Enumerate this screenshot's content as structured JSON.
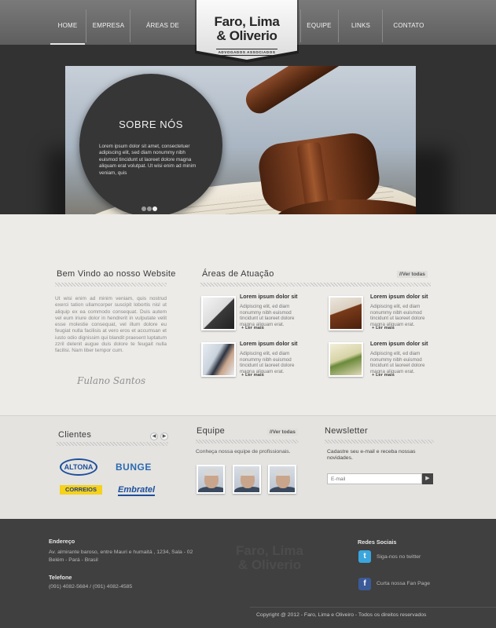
{
  "nav": {
    "items": [
      "HOME",
      "EMPRESA",
      "ÁREAS DE ATUAÇÃO",
      "EQUIPE",
      "LINKS",
      "CONTATO"
    ],
    "active": "HOME"
  },
  "logo": {
    "line1": "Faro, Lima",
    "line2": "& Oliverio",
    "subtitle": "ADVOGADOS ASSOCIADOS"
  },
  "hero": {
    "title": "SOBRE NÓS",
    "text": "Lorem ipsum dolor sit amet, consectetuer adipiscing elit, sed diam nonummy nibh euismod tincidunt ut laoreet dolore magna aliquam erat volutpat. Ut wisi enim ad minim veniam, quis",
    "slides": 3,
    "active_slide": 3
  },
  "welcome": {
    "title": "Bem Vindo ao nosso Website",
    "text": "Ut wisi enim ad minim veniam, quis nostrud exerci tation ullamcorper suscipit lobortis nisl ut aliquip ex ea commodo consequat. Duis autem vel eum iriure dolor in hendrerit in vulputate velit esse molestie consequat, vel illum dolore eu feugiat nulla facilisis at vero eros et accumsan et iusto odio dignissim qui blandit praesent luptatum zzril delenit augue duis dolore te feugait nulla facilisi. Nam liber tempor cum.",
    "signature": "Fulano Santos"
  },
  "areas": {
    "title": "Áreas de Atuação",
    "see_all": "//Ver todas",
    "items": [
      {
        "title": "Lorem ipsum dolor sit",
        "text": "Adipiscing elit, ed diam nonummy nibh euismod tincidunt ut laoreet dolore magna aliquam erat.",
        "more": "+ Ler mais"
      },
      {
        "title": "Lorem ipsum dolor sit",
        "text": "Adipiscing elit, ed diam nonummy nibh euismod tincidunt ut laoreet dolore magna aliquam erat.",
        "more": "+ Ler mais"
      },
      {
        "title": "Lorem ipsum dolor sit",
        "text": "Adipiscing elit, ed diam nonummy nibh euismod tincidunt ut laoreet dolore magna aliquam erat.",
        "more": "+ Ler mais"
      },
      {
        "title": "Lorem ipsum dolor sit",
        "text": "Adipiscing elit, ed diam nonummy nibh euismod tincidunt ut laoreet dolore magna aliquam erat.",
        "more": "+ Ler mais"
      }
    ]
  },
  "clients": {
    "title": "Clientes",
    "logos": [
      "ALTONA",
      "BUNGE",
      "CORREIOS",
      "Embratel"
    ]
  },
  "team": {
    "title": "Equipe",
    "see_all": "//Ver todas",
    "text": "Conheça nossa equipe de profissionais."
  },
  "newsletter": {
    "title": "Newsletter",
    "text": "Cadastre seu e-mail e receba nossas novidades.",
    "placeholder": "E-mail",
    "submit": "▶"
  },
  "footer": {
    "address_label": "Endereço",
    "address_line1": "Av. almirante baroso, entre Mauri e humaitá , 1234, Sala - 02",
    "address_line2": "Belém - Pará - Brasil",
    "phone_label": "Telefone",
    "phones": "(091) 4082-5684 / (091) 4082-4585",
    "social_label": "Redes Sociais",
    "twitter": "Siga-nos no twitter",
    "facebook": "Curta nossa Fan Page",
    "copyright": "Copyright @ 2012 - Faro, Lima e Oliveiro - Todos os direitos reservados",
    "logo_line1": "Faro, Lima",
    "logo_line2": "& Oliverio"
  },
  "colors": {
    "nav": "#6b6b6b",
    "hero_bg": "#323232",
    "footer": "#404040",
    "twitter": "#3aa6dd",
    "facebook": "#3b5a98"
  }
}
